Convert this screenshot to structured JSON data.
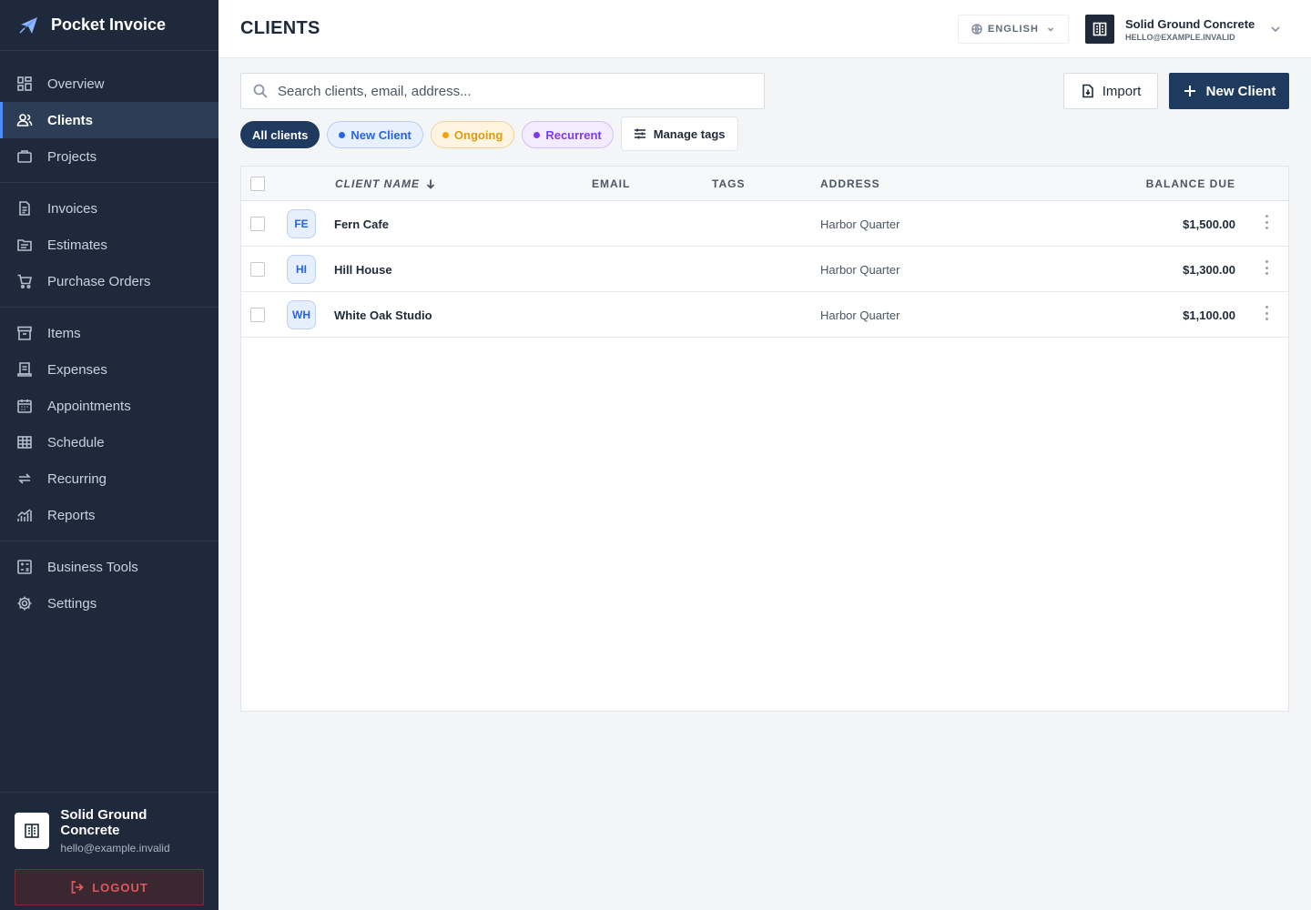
{
  "app": {
    "name": "Pocket Invoice"
  },
  "sidebar": {
    "groups": [
      [
        {
          "label": "Overview",
          "icon": "grid-icon"
        },
        {
          "label": "Clients",
          "icon": "users-icon",
          "active": true
        },
        {
          "label": "Projects",
          "icon": "briefcase-icon"
        }
      ],
      [
        {
          "label": "Invoices",
          "icon": "document-icon"
        },
        {
          "label": "Estimates",
          "icon": "folder-icon"
        },
        {
          "label": "Purchase Orders",
          "icon": "cart-icon"
        }
      ],
      [
        {
          "label": "Items",
          "icon": "archive-icon"
        },
        {
          "label": "Expenses",
          "icon": "receipt-icon"
        },
        {
          "label": "Appointments",
          "icon": "calendar-icon"
        },
        {
          "label": "Schedule",
          "icon": "table-icon"
        },
        {
          "label": "Recurring",
          "icon": "repeat-icon"
        },
        {
          "label": "Reports",
          "icon": "chart-icon"
        }
      ],
      [
        {
          "label": "Business Tools",
          "icon": "calculator-icon"
        },
        {
          "label": "Settings",
          "icon": "gear-icon"
        }
      ]
    ],
    "footer": {
      "account_name": "Solid Ground Concrete",
      "account_email": "hello@example.invalid",
      "logout_label": "LOGOUT"
    }
  },
  "header": {
    "title": "CLIENTS",
    "language": "ENGLISH",
    "account_name": "Solid Ground Concrete",
    "account_email": "HELLO@EXAMPLE.INVALID"
  },
  "toolbar": {
    "search_placeholder": "Search clients, email, address...",
    "import_label": "Import",
    "new_client_label": "New Client"
  },
  "filters": {
    "all": "All clients",
    "new_client": "New Client",
    "ongoing": "Ongoing",
    "recurrent": "Recurrent",
    "manage_tags": "Manage tags"
  },
  "table": {
    "columns": {
      "name": "CLIENT NAME",
      "email": "EMAIL",
      "tags": "TAGS",
      "address": "ADDRESS",
      "balance": "BALANCE DUE"
    },
    "rows": [
      {
        "initials": "FE",
        "name": "Fern Cafe",
        "email": "",
        "tags": "",
        "address": "Harbor Quarter",
        "balance": "$1,500.00"
      },
      {
        "initials": "HI",
        "name": "Hill House",
        "email": "",
        "tags": "",
        "address": "Harbor Quarter",
        "balance": "$1,300.00"
      },
      {
        "initials": "WH",
        "name": "White Oak Studio",
        "email": "",
        "tags": "",
        "address": "Harbor Quarter",
        "balance": "$1,100.00"
      }
    ]
  },
  "colors": {
    "sidebar_bg": "#1e2a3b",
    "primary": "#1e3a5f",
    "accent_blue": "#2563eb",
    "ongoing": "#f5a20a",
    "recurrent": "#7c3aed",
    "logout": "#e4545c"
  }
}
